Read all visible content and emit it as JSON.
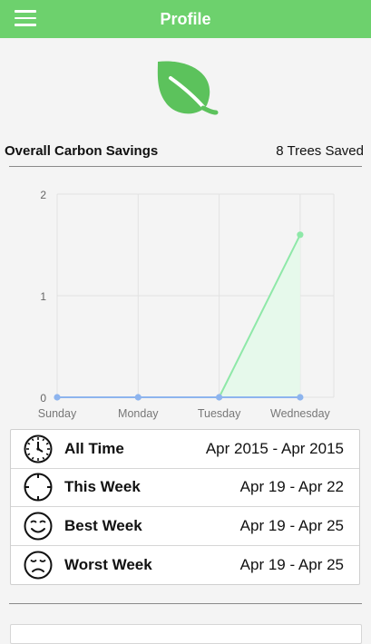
{
  "header": {
    "title": "Profile"
  },
  "summary": {
    "label": "Overall Carbon Savings",
    "trees": "8 Trees Saved"
  },
  "chart_data": {
    "type": "line",
    "categories": [
      "Sunday",
      "Monday",
      "Tuesday",
      "Wednesday"
    ],
    "series": [
      {
        "values": [
          0,
          0,
          0,
          0
        ],
        "color": "#8db4ee"
      },
      {
        "values": [
          null,
          null,
          0,
          1.6
        ],
        "color": "#8ee8a8",
        "fill": "#e6f9eb"
      }
    ],
    "ylim": [
      0,
      2
    ],
    "yticks": [
      "0",
      "1",
      "2"
    ],
    "grid": true
  },
  "stats": [
    {
      "icon": "clock-icon",
      "label": "All Time",
      "value": "Apr 2015 - Apr 2015"
    },
    {
      "icon": "crosshair-icon",
      "label": "This Week",
      "value": "Apr 19 - Apr 22"
    },
    {
      "icon": "smiley-icon",
      "label": "Best Week",
      "value": "Apr 19 - Apr 25"
    },
    {
      "icon": "sad-face-icon",
      "label": "Worst Week",
      "value": "Apr 19 - Apr 25"
    }
  ],
  "colors": {
    "brand": "#6dd16d",
    "leaf": "#5cc25c"
  }
}
